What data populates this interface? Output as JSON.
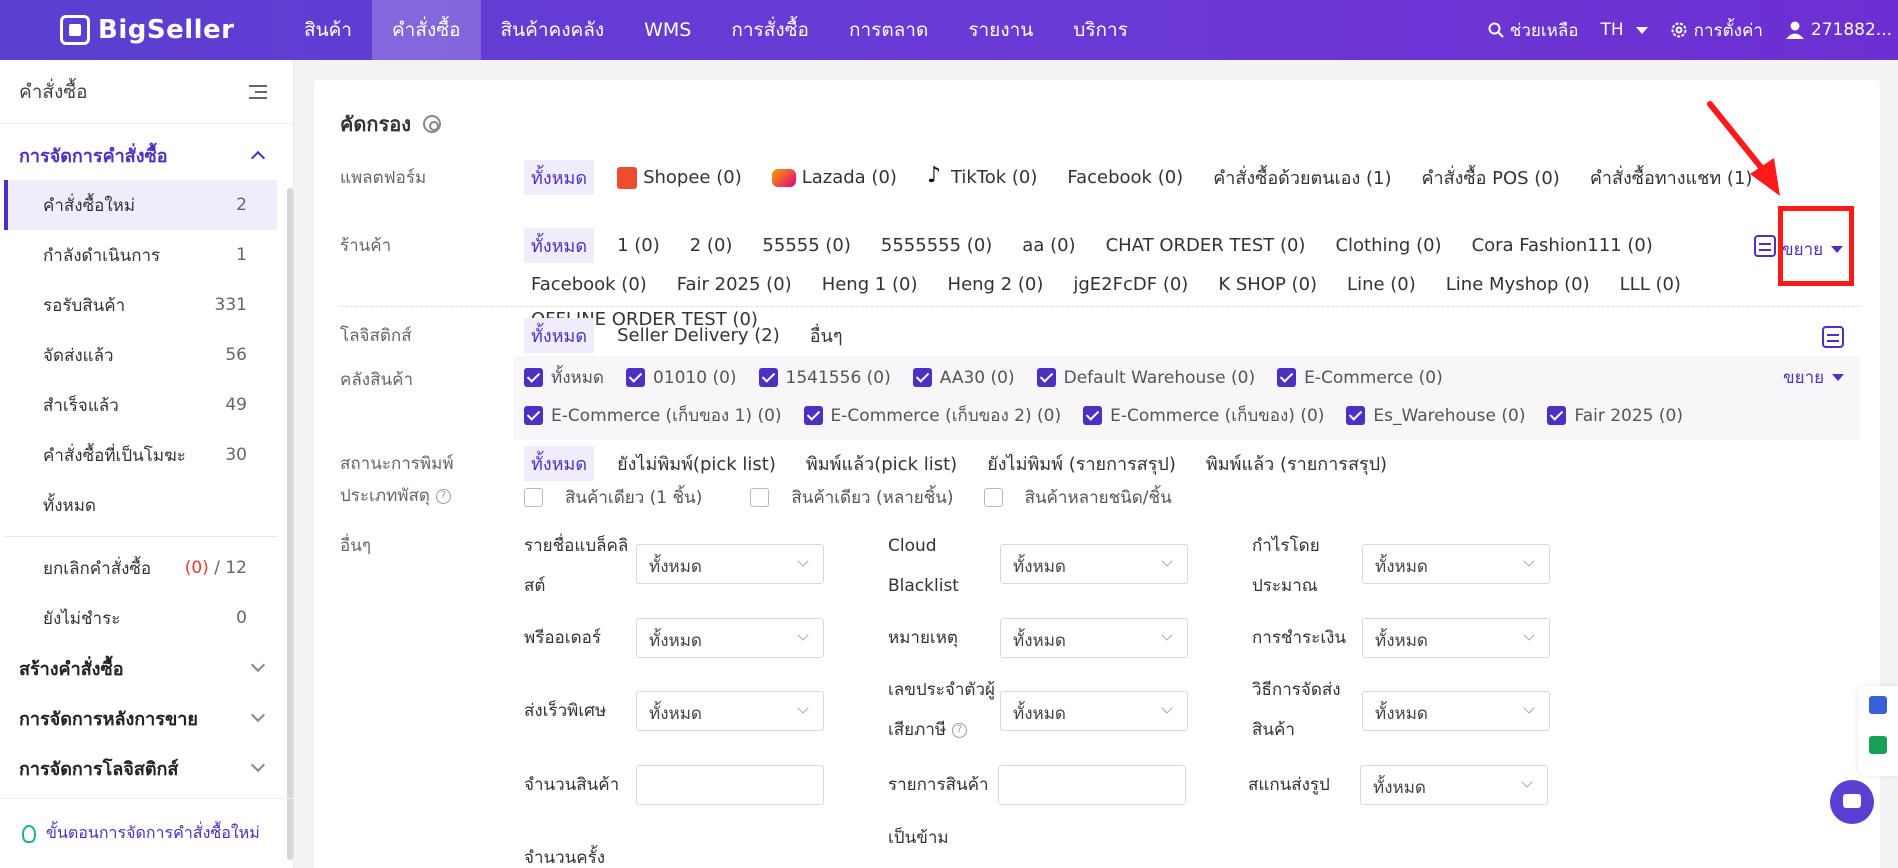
{
  "app": {
    "logo": "BigSeller"
  },
  "nav": {
    "items": [
      "สินค้า",
      "คำสั่งซื้อ",
      "สินค้าคงคลัง",
      "WMS",
      "การสั่งซื้อ",
      "การตลาด",
      "รายงาน",
      "บริการ"
    ],
    "active": "คำสั่งซื้อ"
  },
  "topright": {
    "help": "ช่วยเหลือ",
    "lang": "TH",
    "settings": "การตั้งค่า",
    "user": "271882..."
  },
  "sidebar": {
    "title": "คำสั่งซื้อ",
    "group1": "การจัดการคำสั่งซื้อ",
    "items": [
      {
        "label": "คำสั่งซื้อใหม่",
        "count": "2"
      },
      {
        "label": "กำลังดำเนินการ",
        "count": "1"
      },
      {
        "label": "รอรับสินค้า",
        "count": "331"
      },
      {
        "label": "จัดส่งแล้ว",
        "count": "56"
      },
      {
        "label": "สำเร็จแล้ว",
        "count": "49"
      },
      {
        "label": "คำสั่งซื้อที่เป็นโมฆะ",
        "count": "30"
      },
      {
        "label": "ทั้งหมด",
        "count": ""
      }
    ],
    "cancel": {
      "label": "ยกเลิกคำสั่งซื้อ",
      "red": "(0)",
      "sep": " / ",
      "total": "12"
    },
    "unpaid": {
      "label": "ยังไม่ชำระ",
      "count": "0"
    },
    "groups": [
      "สร้างคำสั่งซื้อ",
      "การจัดการหลังการขาย",
      "การจัดการโลจิสติกส์"
    ],
    "footer": "ขั้นตอนการจัดการคำสั่งซื้อใหม่"
  },
  "filter": {
    "title": "คัดกรอง",
    "platform": {
      "label": "แพลตฟอร์ม",
      "chips": [
        "ทั้งหมด",
        "Shopee (0)",
        "Lazada (0)",
        "TikTok (0)",
        "Facebook (0)",
        "คำสั่งซื้อด้วยตนเอง (1)",
        "คำสั่งซื้อ POS (0)",
        "คำสั่งซื้อทางแชท (1)"
      ]
    },
    "store": {
      "label": "ร้านค้า",
      "chips": [
        "ทั้งหมด",
        "1 (0)",
        "2 (0)",
        "55555 (0)",
        "5555555 (0)",
        "aa (0)",
        "CHAT ORDER TEST (0)",
        "Clothing (0)",
        "Cora Fashion111 (0)",
        "Facebook (0)",
        "Fair 2025 (0)",
        "Heng 1 (0)",
        "Heng 2 (0)",
        "jgE2FcDF (0)",
        "K SHOP (0)",
        "Line (0)",
        "Line Myshop (0)",
        "LLL (0)",
        "OFFLINE ORDER TEST (0)"
      ],
      "expand": "ขยาย"
    },
    "logistics": {
      "label": "โลจิสติกส์",
      "chips": [
        "ทั้งหมด",
        "Seller Delivery (2)",
        "อื่นๆ"
      ]
    },
    "warehouse": {
      "label": "คลังสินค้า",
      "row1": [
        "ทั้งหมด",
        "01010 (0)",
        "1541556 (0)",
        "AA30 (0)",
        "Default Warehouse (0)",
        "E-Commerce (0)"
      ],
      "row2": [
        "E-Commerce (เก็บของ 1) (0)",
        "E-Commerce (เก็บของ 2) (0)",
        "E-Commerce (เก็บของ) (0)",
        "Es_Warehouse (0)",
        "Fair 2025 (0)"
      ],
      "expand": "ขยาย"
    },
    "print": {
      "label": "สถานะการพิมพ์",
      "chips": [
        "ทั้งหมด",
        "ยังไม่พิมพ์(pick list)",
        "พิมพ์แล้ว(pick list)",
        "ยังไม่พิมพ์ (รายการสรุป)",
        "พิมพ์แล้ว (รายการสรุป)"
      ]
    },
    "parcel": {
      "label": "ประเภทพัสดุ",
      "help": "?",
      "opts": [
        "สินค้าเดียว (1 ชิ้น)",
        "สินค้าเดียว (หลายชิ้น)",
        "สินค้าหลายชนิด/ชิ้น"
      ]
    },
    "other": {
      "label": "อื่นๆ",
      "all": "ทั้งหมด",
      "fields": {
        "blacklist1": "รายชื่อแบล็คลิ",
        "blacklist2": "สต์",
        "cloud1": "Cloud",
        "cloud2": "Blacklist",
        "profit1": "กำไรโดย",
        "profit2": "ประมาณ",
        "preorder": "พรีออเดอร์",
        "note": "หมายเหตุ",
        "payment": "การชำระเงิน",
        "express": "ส่งเร็วพิเศษ",
        "taxid1": "เลขประจำตัวผู้",
        "taxid2": "เสียภาษี",
        "shipmethod1": "วิธีการจัดส่ง",
        "shipmethod2": "สินค้า",
        "qty": "จำนวนสินค้า",
        "items": "รายการสินค้า",
        "scan": "สแกนส่งรูป",
        "count1": "จำนวนครั้ง",
        "cross": "เป็นข้าม"
      }
    }
  }
}
